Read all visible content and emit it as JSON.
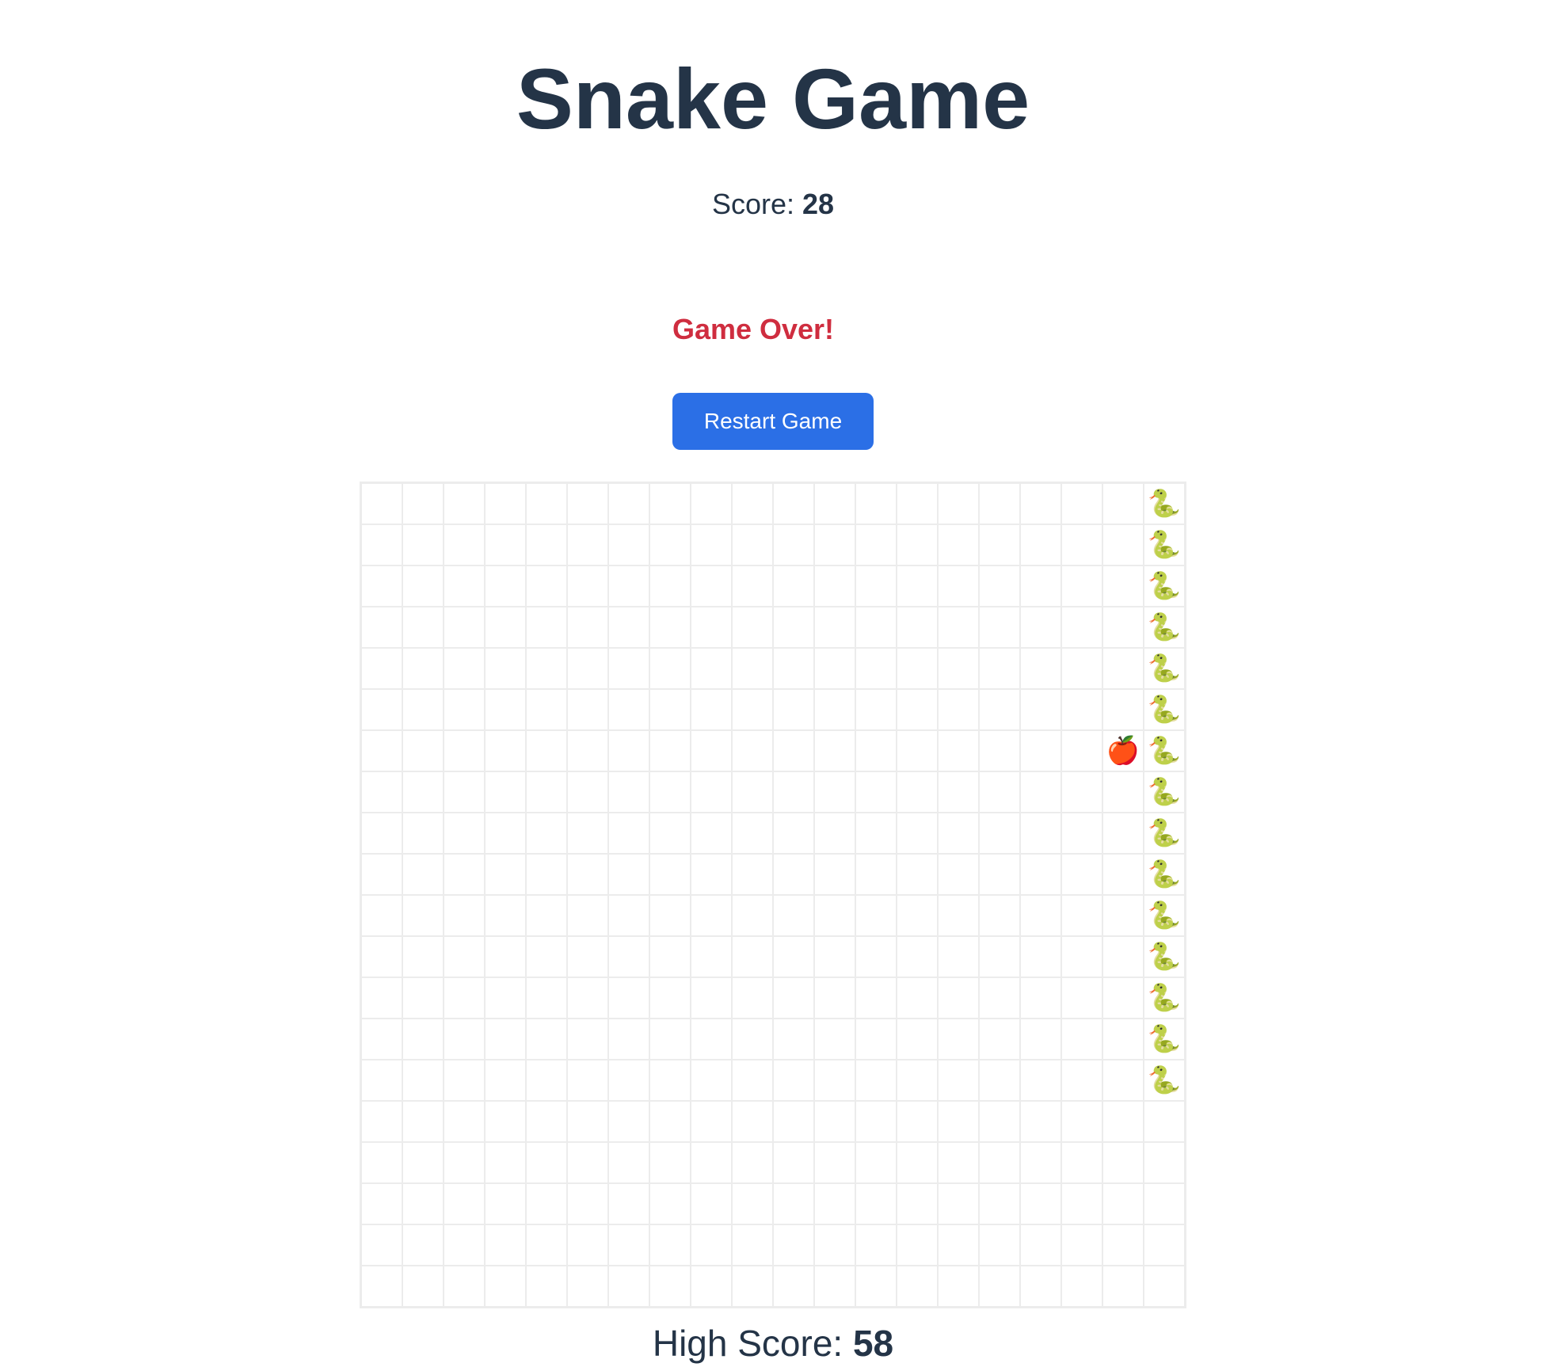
{
  "header": {
    "title": "Snake Game"
  },
  "score": {
    "label": "Score: ",
    "value": "28"
  },
  "status": {
    "message": "Game Over!",
    "color": "#cf2d3f"
  },
  "controls": {
    "restart_label": "Restart Game",
    "accent_color": "#2b6fe6"
  },
  "board": {
    "columns": 20,
    "rows": 20,
    "snake_icon": "snake-icon",
    "food_icon": "apple-icon",
    "snake_glyph": "🐍",
    "food_glyph": "🍎",
    "snake_cells": [
      [
        19,
        0
      ],
      [
        19,
        1
      ],
      [
        19,
        2
      ],
      [
        19,
        3
      ],
      [
        19,
        4
      ],
      [
        19,
        5
      ],
      [
        19,
        6
      ],
      [
        19,
        7
      ],
      [
        19,
        8
      ],
      [
        19,
        9
      ],
      [
        19,
        10
      ],
      [
        19,
        11
      ],
      [
        19,
        12
      ],
      [
        19,
        13
      ],
      [
        19,
        14
      ]
    ],
    "food_cell": [
      18,
      6
    ]
  },
  "high_score": {
    "label": "High Score: ",
    "value": "58"
  }
}
